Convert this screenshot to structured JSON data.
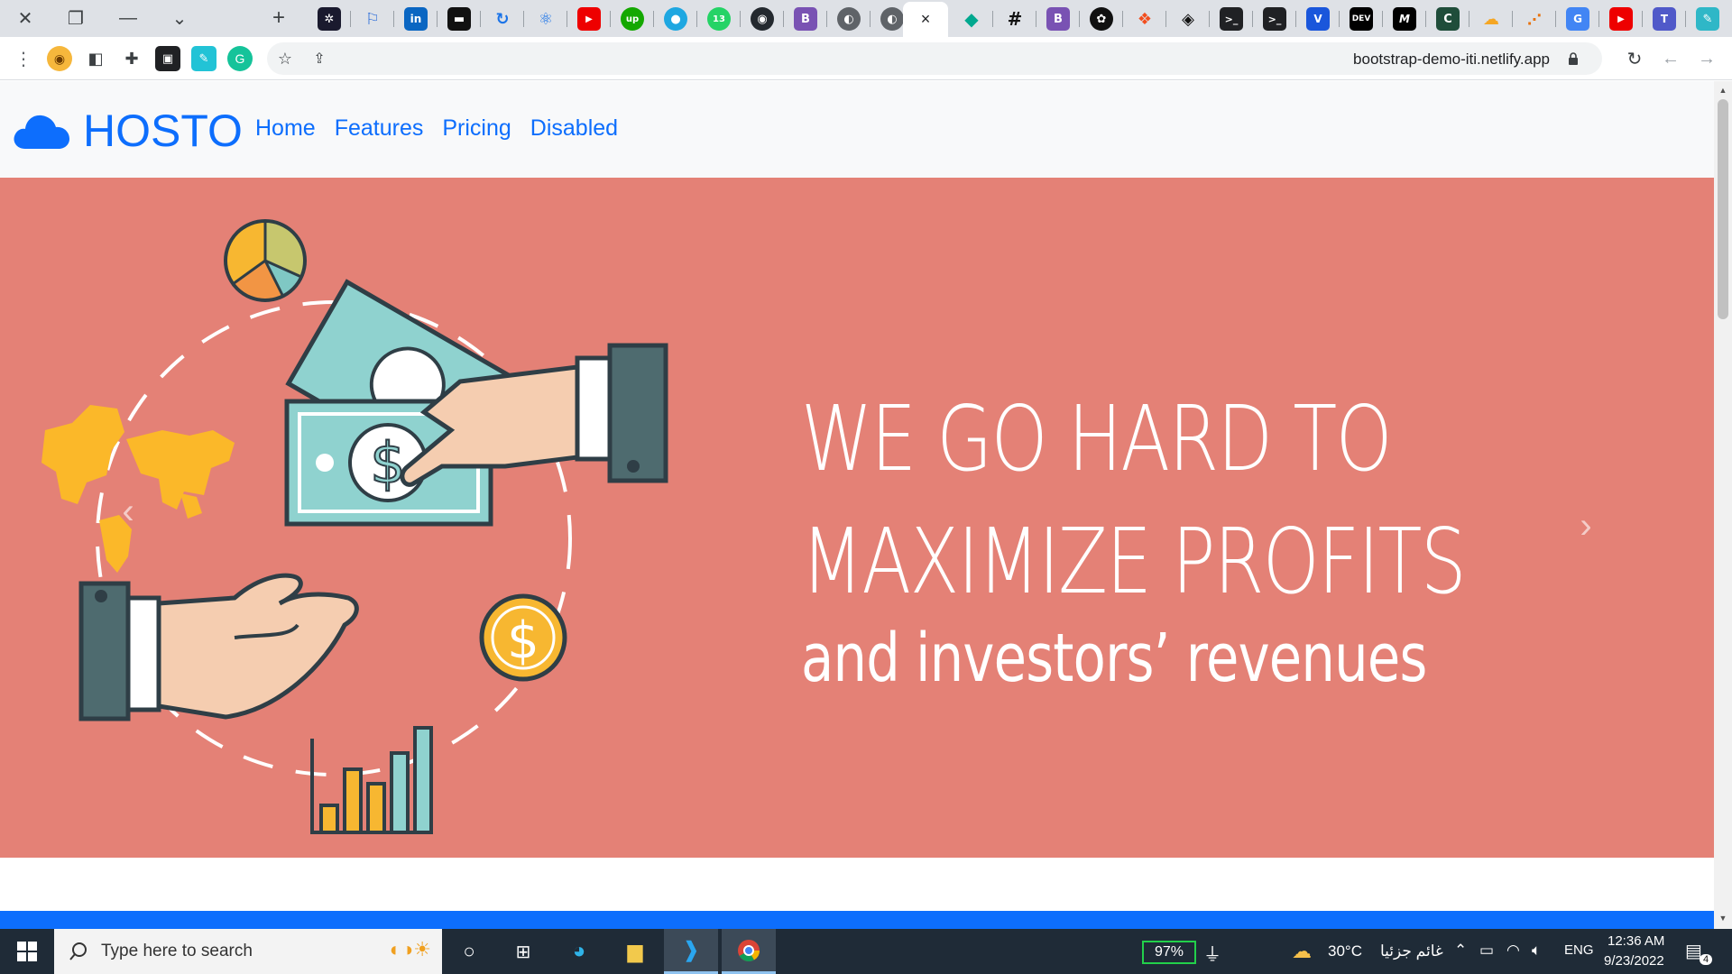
{
  "browser": {
    "address_url": "bootstrap-demo-iti.netlify.app",
    "active_tab_close": "×",
    "tab_icons": [
      "perplexity-icon",
      "flag-icon",
      "linkedin-icon",
      "notion-icon",
      "sync-icon",
      "react-icon",
      "youtube-icon",
      "upwork-icon",
      "circle-icon",
      "whatsapp-icon",
      "github-icon",
      "bootstrap-icon",
      "globe-icon",
      "globe-icon",
      "active-tab",
      "diamond-icon",
      "hash-icon",
      "bootstrap-icon",
      "chatgpt-icon",
      "figma-icon",
      "codepen-icon",
      "terminal-icon",
      "terminal-icon",
      "vmware-icon",
      "dev-icon",
      "medium-icon",
      "codewars-icon",
      "cloud-icon",
      "chart-icon",
      "translate-icon",
      "youtube-icon",
      "teams-icon",
      "notepad-icon"
    ]
  },
  "site": {
    "brand": "HOSTO",
    "nav": [
      "Home",
      "Features",
      "Pricing",
      "Disabled"
    ]
  },
  "hero": {
    "line1": "WE GO HARD TO",
    "line2": "MAXIMIZE PROFITS",
    "subline": "and investors’ revenues",
    "prev_glyph": "‹",
    "next_glyph": "›",
    "background_color": "#e48176"
  },
  "taskbar": {
    "search_placeholder": "Type here to search",
    "battery": "97%",
    "temperature": "30°C",
    "weather": "غائم جزئيا",
    "language": "ENG",
    "time": "12:36 AM",
    "date": "9/23/2022",
    "notifications": "4"
  }
}
